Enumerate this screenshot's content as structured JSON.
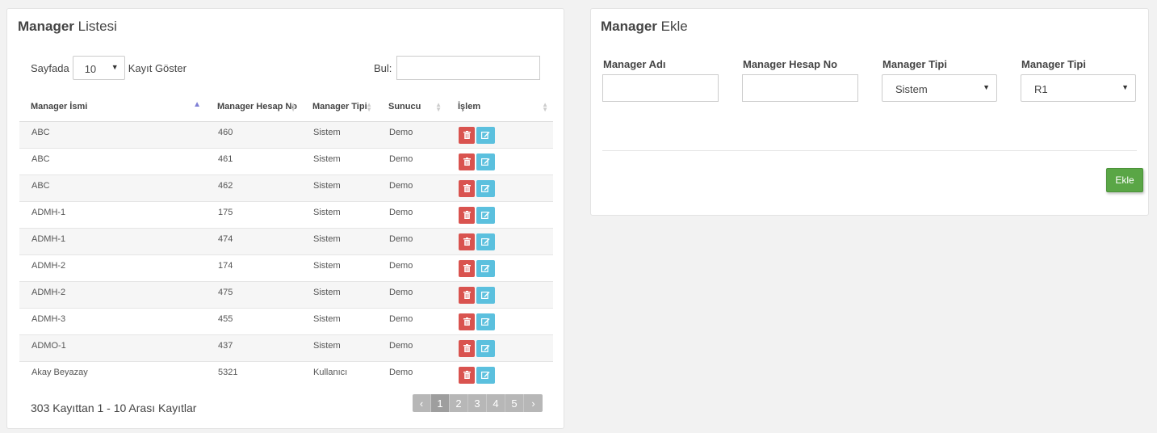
{
  "list_panel": {
    "title_bold": "Manager",
    "title_rest": "Listesi",
    "length_prefix": "Sayfada",
    "length_value": "10",
    "length_suffix": "Kayıt Göster",
    "search_label": "Bul:",
    "search_value": "",
    "columns": [
      "Manager İsmi",
      "Manager Hesap No",
      "Manager Tipi",
      "Sunucu",
      "İşlem"
    ],
    "rows": [
      [
        "ABC",
        "460",
        "Sistem",
        "Demo"
      ],
      [
        "ABC",
        "461",
        "Sistem",
        "Demo"
      ],
      [
        "ABC",
        "462",
        "Sistem",
        "Demo"
      ],
      [
        "ADMH-1",
        "175",
        "Sistem",
        "Demo"
      ],
      [
        "ADMH-1",
        "474",
        "Sistem",
        "Demo"
      ],
      [
        "ADMH-2",
        "174",
        "Sistem",
        "Demo"
      ],
      [
        "ADMH-2",
        "475",
        "Sistem",
        "Demo"
      ],
      [
        "ADMH-3",
        "455",
        "Sistem",
        "Demo"
      ],
      [
        "ADMO-1",
        "437",
        "Sistem",
        "Demo"
      ],
      [
        "Akay Beyazay",
        "5321",
        "Kullanıcı",
        "Demo"
      ]
    ],
    "icons": {
      "delete": "trash-icon",
      "edit": "edit-icon"
    },
    "info": "303 Kayıttan 1 - 10 Arası Kayıtlar",
    "pager": {
      "prev": "‹",
      "pages": [
        "1",
        "2",
        "3",
        "4",
        "5"
      ],
      "active_page": "1",
      "next": "›"
    }
  },
  "add_panel": {
    "title_bold": "Manager",
    "title_rest": "Ekle",
    "fields": {
      "name_label": "Manager Adı",
      "name_value": "",
      "account_label": "Manager Hesap No",
      "account_value": "",
      "type_label": "Manager Tipi",
      "type_value": "Sistem",
      "type2_label": "Manager Tipi",
      "type2_value": "R1"
    },
    "submit_label": "Ekle"
  },
  "colors": {
    "delete_button": "#d9534f",
    "edit_button": "#5bc0de",
    "add_button": "#5aa646",
    "sort_active": "#7f7fd5"
  }
}
